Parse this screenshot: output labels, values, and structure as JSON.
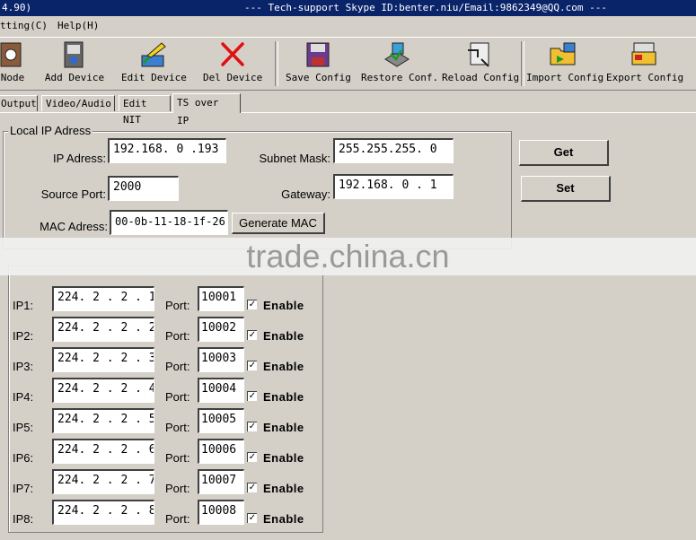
{
  "titlebar": {
    "left": "4.90)",
    "center": "--- Tech-support Skype ID:benter.niu/Email:9862349@QQ.com ---"
  },
  "menu": {
    "items": [
      "tting(C)",
      "Help(H)"
    ]
  },
  "toolbar": {
    "items": [
      {
        "label": "Node",
        "icon": "node-icon"
      },
      {
        "label": "Add Device",
        "icon": "add-device-icon"
      },
      {
        "label": "Edit Device",
        "icon": "edit-device-icon"
      },
      {
        "label": "Del Device",
        "icon": "delete-icon"
      },
      {
        "label": "Save Config",
        "icon": "save-icon"
      },
      {
        "label": "Restore Conf.",
        "icon": "restore-icon"
      },
      {
        "label": "Reload Config",
        "icon": "reload-icon"
      },
      {
        "label": "Import Config",
        "icon": "import-icon"
      },
      {
        "label": "Export Config",
        "icon": "export-icon"
      }
    ]
  },
  "tabs": [
    {
      "label": "Output"
    },
    {
      "label": "Video/Audio"
    },
    {
      "label": "Edit NIT"
    },
    {
      "label": "TS over IP",
      "active": true
    }
  ],
  "local_ip": {
    "legend": "Local IP Adress",
    "ip_label": "IP Adress:",
    "ip_value": "192.168. 0 .193",
    "mask_label": "Subnet Mask:",
    "mask_value": "255.255.255. 0",
    "port_label": "Source Port:",
    "port_value": "2000",
    "gateway_label": "Gateway:",
    "gateway_value": "192.168. 0 . 1",
    "mac_label": "MAC Adress:",
    "mac_value": "00-0b-11-18-1f-26",
    "generate_mac": "Generate MAC"
  },
  "buttons": {
    "get": "Get",
    "set": "Set"
  },
  "watermark": "trade.china.cn",
  "outputs": {
    "port_label": "Port:",
    "enable_label": "Enable",
    "rows": [
      {
        "label": "IP1:",
        "ip": "224. 2 . 2 . 1",
        "port": "10001",
        "enabled": true
      },
      {
        "label": "IP2:",
        "ip": "224. 2 . 2 . 2",
        "port": "10002",
        "enabled": true
      },
      {
        "label": "IP3:",
        "ip": "224. 2 . 2 . 3",
        "port": "10003",
        "enabled": true
      },
      {
        "label": "IP4:",
        "ip": "224. 2 . 2 . 4",
        "port": "10004",
        "enabled": true
      },
      {
        "label": "IP5:",
        "ip": "224. 2 . 2 . 5",
        "port": "10005",
        "enabled": true
      },
      {
        "label": "IP6:",
        "ip": "224. 2 . 2 . 6",
        "port": "10006",
        "enabled": true
      },
      {
        "label": "IP7:",
        "ip": "224. 2 . 2 . 7",
        "port": "10007",
        "enabled": true
      },
      {
        "label": "IP8:",
        "ip": "224. 2 . 2 . 8",
        "port": "10008",
        "enabled": true
      }
    ]
  }
}
